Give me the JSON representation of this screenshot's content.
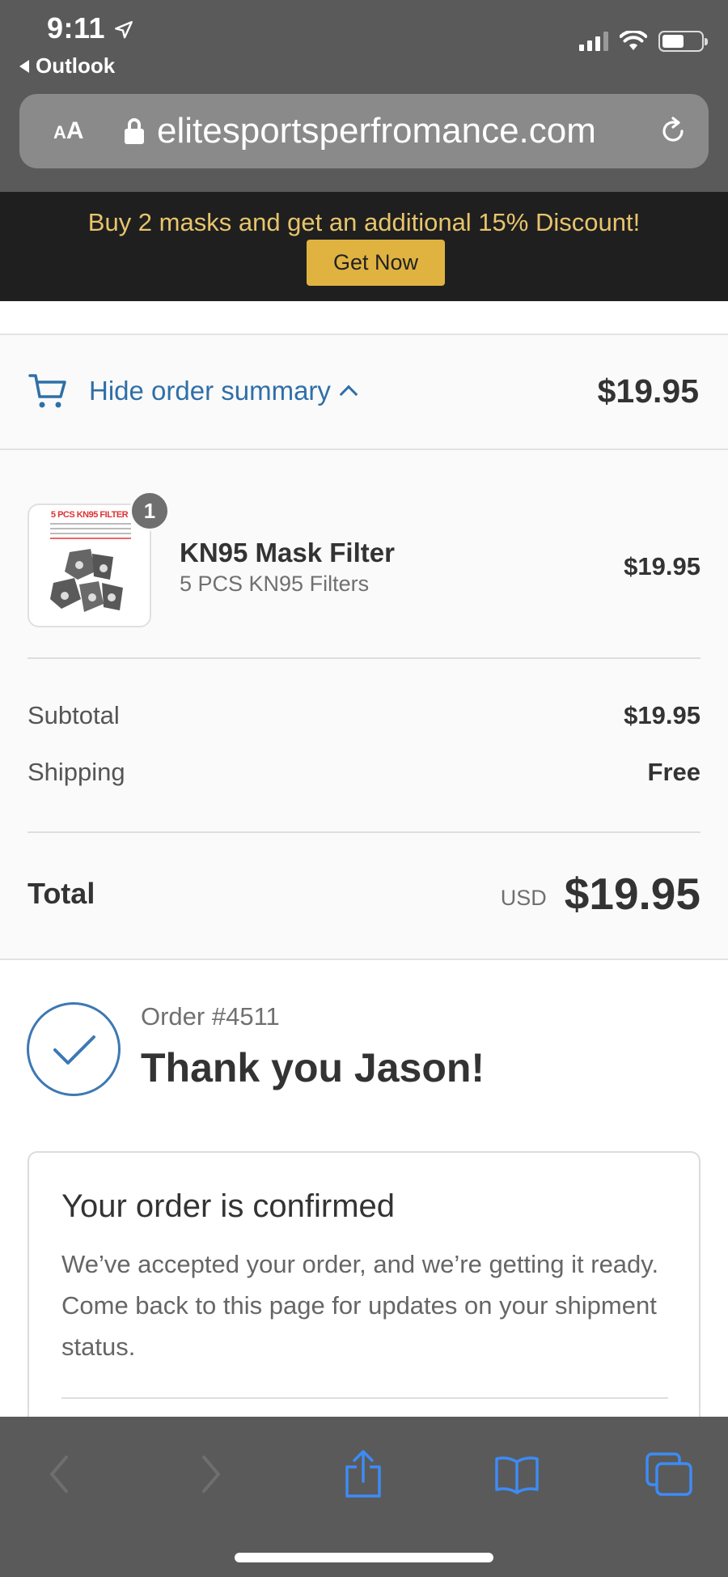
{
  "status_bar": {
    "time": "9:11",
    "back_app": "Outlook"
  },
  "browser": {
    "text_size_label_big": "A",
    "text_size_label_small": "A",
    "url": "elitesportsperfromance.com"
  },
  "promo": {
    "text": "Buy 2 masks and get an additional 15% Discount!",
    "button_label": "Get Now"
  },
  "summary": {
    "toggle_label": "Hide order summary",
    "toggle_total": "$19.95",
    "product": {
      "quantity": "1",
      "image_caption": "5 PCS KN95 FILTER",
      "name": "KN95 Mask Filter",
      "variant": "5 PCS KN95 Filters",
      "price": "$19.95"
    },
    "subtotal_label": "Subtotal",
    "subtotal_value": "$19.95",
    "shipping_label": "Shipping",
    "shipping_value": "Free",
    "total_label": "Total",
    "total_currency": "USD",
    "total_value": "$19.95"
  },
  "confirmation": {
    "order_number": "Order #4511",
    "thank_you": "Thank you Jason!",
    "card_title": "Your order is confirmed",
    "card_body": "We’ve accepted your order, and we’re getting it ready. Come back to this page for updates on your shipment status."
  },
  "toolbar_icons": [
    "back-icon",
    "forward-icon",
    "share-icon",
    "bookmarks-icon",
    "tabs-icon"
  ],
  "colors": {
    "chrome": "#5a5a5a",
    "promo_bg": "#1f1f1f",
    "promo_text": "#e7c46c",
    "promo_button": "#e0b341",
    "link_blue": "#2f6fa8",
    "toolbar_icon_blue": "#3d8bf5"
  }
}
